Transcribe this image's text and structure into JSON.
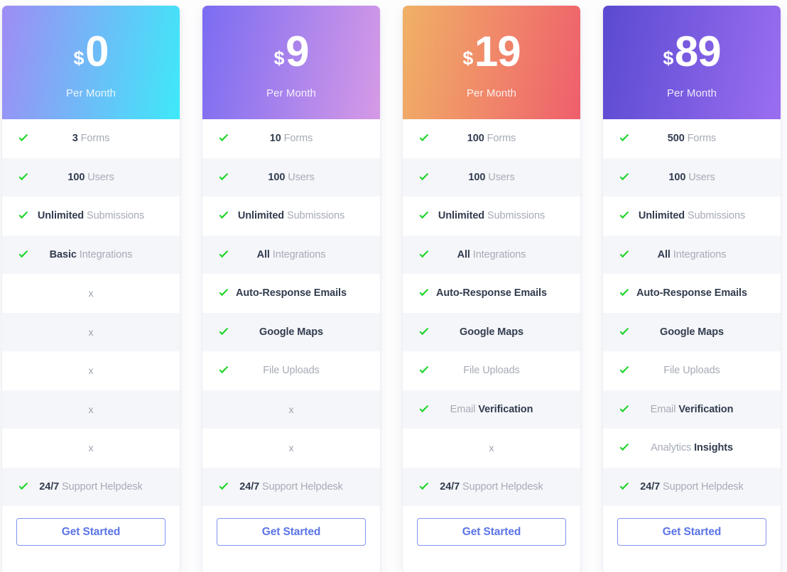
{
  "page": {
    "background_color": "#fdfdfe",
    "check_icon_color": "#1fd52a",
    "cross_icon_color": "#9ba1ad",
    "row_alt_color": "#f5f6fa",
    "strong_text_color": "#323c4e",
    "muted_text_color": "#a6abb5"
  },
  "plans": [
    {
      "name": "free-plan",
      "currency": "$",
      "amount": "0",
      "period": "Per Month",
      "gradient_from": "#9f8cf5",
      "gradient_to": "#3ee9f9",
      "cta_label": "Get Started",
      "cta_border_color": "#8294f0",
      "cta_text_color": "#5b74e8",
      "features": [
        {
          "included": true,
          "strong": "3",
          "muted": "Forms"
        },
        {
          "included": true,
          "strong": "100",
          "muted": "Users"
        },
        {
          "included": true,
          "strong": "Unlimited",
          "muted": "Submissions"
        },
        {
          "included": true,
          "strong": "Basic",
          "muted": "Integrations"
        },
        {
          "included": false,
          "strong": "",
          "muted": ""
        },
        {
          "included": false,
          "strong": "",
          "muted": ""
        },
        {
          "included": false,
          "strong": "",
          "muted": ""
        },
        {
          "included": false,
          "strong": "",
          "muted": ""
        },
        {
          "included": false,
          "strong": "",
          "muted": ""
        },
        {
          "included": true,
          "strong": "24/7",
          "muted": "Support Helpdesk"
        }
      ]
    },
    {
      "name": "starter-plan",
      "currency": "$",
      "amount": "9",
      "period": "Per Month",
      "gradient_from": "#7b6cf2",
      "gradient_to": "#d69ae6",
      "cta_label": "Get Started",
      "cta_border_color": "#8294f0",
      "cta_text_color": "#5b74e8",
      "features": [
        {
          "included": true,
          "strong": "10",
          "muted": "Forms"
        },
        {
          "included": true,
          "strong": "100",
          "muted": "Users"
        },
        {
          "included": true,
          "strong": "Unlimited",
          "muted": "Submissions"
        },
        {
          "included": true,
          "strong": "All",
          "muted": "Integrations"
        },
        {
          "included": true,
          "strong": "Auto-Response Emails",
          "muted": ""
        },
        {
          "included": true,
          "strong": "Google Maps",
          "muted": ""
        },
        {
          "included": true,
          "strong": "",
          "muted": "File Uploads"
        },
        {
          "included": false,
          "strong": "",
          "muted": ""
        },
        {
          "included": false,
          "strong": "",
          "muted": ""
        },
        {
          "included": true,
          "strong": "24/7",
          "muted": "Support Helpdesk"
        }
      ]
    },
    {
      "name": "pro-plan",
      "currency": "$",
      "amount": "19",
      "period": "Per Month",
      "gradient_from": "#f0b166",
      "gradient_to": "#ef5f6c",
      "cta_label": "Get Started",
      "cta_border_color": "#8294f0",
      "cta_text_color": "#5b74e8",
      "features": [
        {
          "included": true,
          "strong": "100",
          "muted": "Forms"
        },
        {
          "included": true,
          "strong": "100",
          "muted": "Users"
        },
        {
          "included": true,
          "strong": "Unlimited",
          "muted": "Submissions"
        },
        {
          "included": true,
          "strong": "All",
          "muted": "Integrations"
        },
        {
          "included": true,
          "strong": "Auto-Response Emails",
          "muted": ""
        },
        {
          "included": true,
          "strong": "Google Maps",
          "muted": ""
        },
        {
          "included": true,
          "strong": "",
          "muted": "File Uploads"
        },
        {
          "included": true,
          "muted_first": "Email",
          "strong": "Verification"
        },
        {
          "included": false,
          "strong": "",
          "muted": ""
        },
        {
          "included": true,
          "strong": "24/7",
          "muted": "Support Helpdesk"
        }
      ]
    },
    {
      "name": "business-plan",
      "currency": "$",
      "amount": "89",
      "period": "Per Month",
      "gradient_from": "#5a4ad1",
      "gradient_to": "#9b6ef0",
      "cta_label": "Get Started",
      "cta_border_color": "#8294f0",
      "cta_text_color": "#5b74e8",
      "features": [
        {
          "included": true,
          "strong": "500",
          "muted": "Forms"
        },
        {
          "included": true,
          "strong": "100",
          "muted": "Users"
        },
        {
          "included": true,
          "strong": "Unlimited",
          "muted": "Submissions"
        },
        {
          "included": true,
          "strong": "All",
          "muted": "Integrations"
        },
        {
          "included": true,
          "strong": "Auto-Response Emails",
          "muted": ""
        },
        {
          "included": true,
          "strong": "Google Maps",
          "muted": ""
        },
        {
          "included": true,
          "strong": "",
          "muted": "File Uploads"
        },
        {
          "included": true,
          "muted_first": "Email",
          "strong": "Verification"
        },
        {
          "included": true,
          "muted_first": "Analytics",
          "strong": "Insights"
        },
        {
          "included": true,
          "strong": "24/7",
          "muted": "Support Helpdesk"
        }
      ]
    }
  ],
  "icons": {
    "check": "check-icon",
    "cross": "x"
  }
}
